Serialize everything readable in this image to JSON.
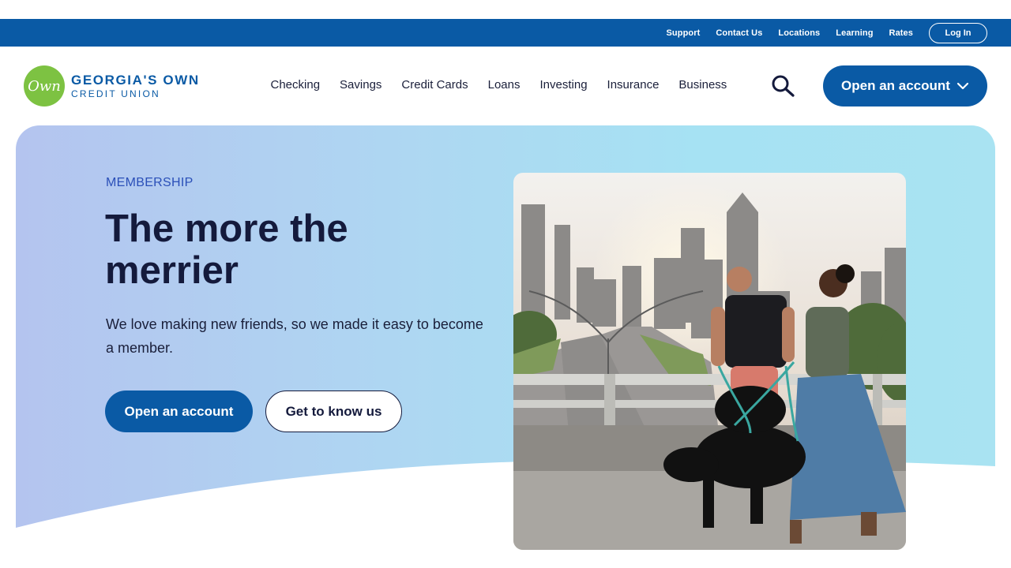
{
  "utility_nav": {
    "links": [
      "Support",
      "Contact Us",
      "Locations",
      "Learning",
      "Rates"
    ],
    "login_label": "Log In"
  },
  "brand": {
    "badge_text": "Own",
    "name_line1": "GEORGIA'S OWN",
    "name_line2": "CREDIT UNION"
  },
  "main_nav": {
    "items": [
      "Checking",
      "Savings",
      "Credit Cards",
      "Loans",
      "Investing",
      "Insurance",
      "Business"
    ],
    "search_icon": "search-icon",
    "cta_label": "Open an account",
    "cta_icon": "chevron-down-icon"
  },
  "hero": {
    "eyebrow": "MEMBERSHIP",
    "headline": "The more the merrier",
    "subcopy": "We love making new friends, so we made it easy to become a member.",
    "primary_button": "Open an account",
    "secondary_button": "Get to know us"
  },
  "colors": {
    "brand_blue": "#0a5aa5",
    "brand_green": "#7dc242",
    "heading_navy": "#141a3c",
    "eyebrow_blue": "#2a4fb8"
  }
}
